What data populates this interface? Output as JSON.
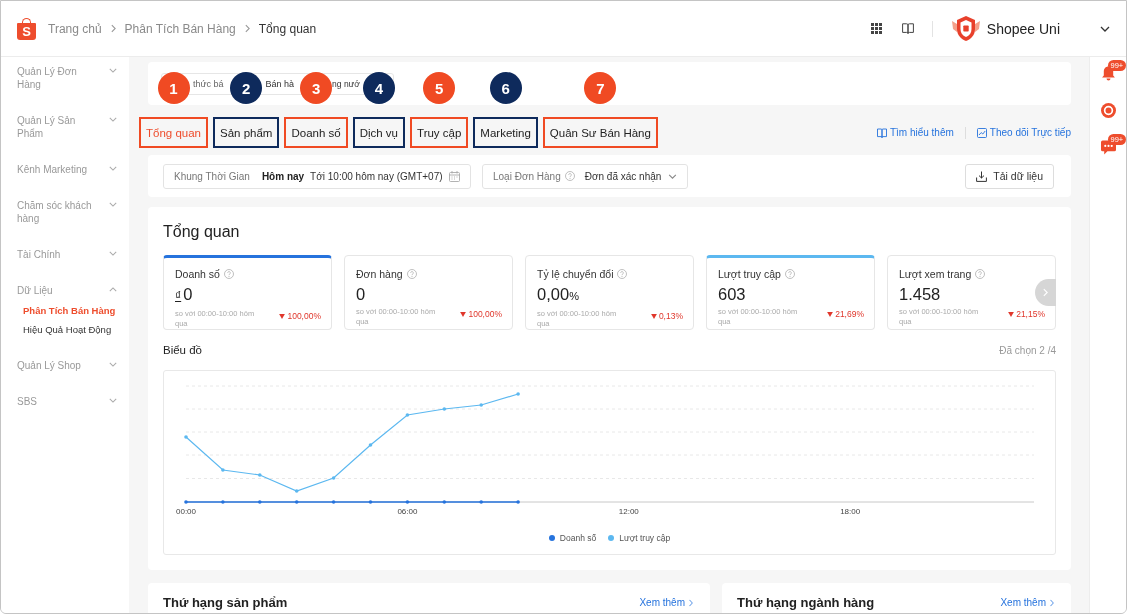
{
  "topbar": {
    "logo": "S",
    "breadcrumb": [
      {
        "label": "Trang chủ",
        "current": false
      },
      {
        "label": "Phân Tích Bán Hàng",
        "current": false
      },
      {
        "label": "Tổng quan",
        "current": true
      }
    ],
    "account": {
      "name": "Shopee Uni"
    }
  },
  "sidebar": {
    "items": [
      {
        "label": "Quản Lý Đơn Hàng",
        "expanded": false
      },
      {
        "label": "Quản Lý Sản Phẩm",
        "expanded": false
      },
      {
        "label": "Kênh Marketing",
        "expanded": false
      },
      {
        "label": "Chăm sóc khách hàng",
        "expanded": false
      },
      {
        "label": "Tài Chính",
        "expanded": false
      },
      {
        "label": "Dữ Liệu",
        "expanded": true,
        "children": [
          {
            "label": "Phân Tích Bán Hàng",
            "selected": true
          },
          {
            "label": "Hiệu Quả Hoạt Động",
            "selected": false
          }
        ]
      },
      {
        "label": "Quản Lý Shop",
        "expanded": false
      },
      {
        "label": "SBS",
        "expanded": false
      }
    ]
  },
  "sales_channel": {
    "label": "thức bá",
    "value_parts": [
      "Bán hà",
      "ng nướ"
    ]
  },
  "tabs": [
    {
      "label": "Tổng quan",
      "selected": true,
      "marker": "1",
      "color": "#f04a23"
    },
    {
      "label": "Sản phẩm",
      "selected": false,
      "marker": "2",
      "color": "#0e2a5c"
    },
    {
      "label": "Doanh số",
      "selected": false,
      "marker": "3",
      "color": "#f04a23"
    },
    {
      "label": "Dịch vụ",
      "selected": false,
      "marker": "4",
      "color": "#0e2a5c"
    },
    {
      "label": "Truy cập",
      "selected": false,
      "marker": "5",
      "color": "#f04a23"
    },
    {
      "label": "Marketing",
      "selected": false,
      "marker": "6",
      "color": "#0e2a5c"
    },
    {
      "label": "Quân Sư Bán Hàng",
      "selected": false,
      "marker": "7",
      "color": "#f04a23"
    }
  ],
  "links": [
    {
      "kind": "guide",
      "label": "Tìm hiểu thêm"
    },
    {
      "kind": "live",
      "label": "Theo dõi Trực tiếp"
    }
  ],
  "filters": {
    "time": {
      "label": "Khung Thời Gian",
      "period": "Hôm nay",
      "range": "Tới 10:00 hôm nay (GMT+07)"
    },
    "order_type": {
      "label": "Loại Đơn Hàng",
      "value": "Đơn đã xác nhận"
    },
    "download_button": "Tải dữ liệu"
  },
  "overview": {
    "title": "Tổng quan",
    "metrics": [
      {
        "label": "Doanh số",
        "prefix": "₫",
        "value": "0",
        "compare": "so với 00:00-10:00 hôm qua",
        "change": "100,00%",
        "selected": true,
        "color": "#2673dd"
      },
      {
        "label": "Đơn hàng",
        "value": "0",
        "compare": "so với 00:00-10:00 hôm qua",
        "change": "100,00%",
        "selected": false
      },
      {
        "label": "Tỷ lệ chuyển đổi",
        "value": "0,00",
        "suffix": "%",
        "compare": "so với 00:00-10:00 hôm qua",
        "change": "0,13%",
        "selected": false
      },
      {
        "label": "Lượt truy cập",
        "value": "603",
        "compare": "so với 00:00-10:00 hôm qua",
        "change": "21,69%",
        "selected": true,
        "color": "#5cb8f0"
      },
      {
        "label": "Lượt xem trang",
        "value": "1.458",
        "compare": "so với 00:00-10:00 hôm qua",
        "change": "21,15%",
        "selected": false
      }
    ],
    "chart": {
      "title": "Biểu đồ",
      "selection": "Đã chọn 2 /4",
      "x_ticks": [
        "00:00",
        "06:00",
        "12:00",
        "18:00"
      ],
      "legend": [
        {
          "label": "Doanh số",
          "color": "#2673dd"
        },
        {
          "label": "Lượt truy cập",
          "color": "#5cb8f0"
        }
      ]
    }
  },
  "rankings": [
    {
      "title": "Thứ hạng sản phẩm",
      "link": "Xem thêm"
    },
    {
      "title": "Thứ hạng ngành hàng",
      "link": "Xem thêm"
    }
  ],
  "right_rail": [
    {
      "kind": "bell",
      "badge": "99+"
    },
    {
      "kind": "ring"
    },
    {
      "kind": "chat",
      "badge": "99+"
    }
  ]
}
